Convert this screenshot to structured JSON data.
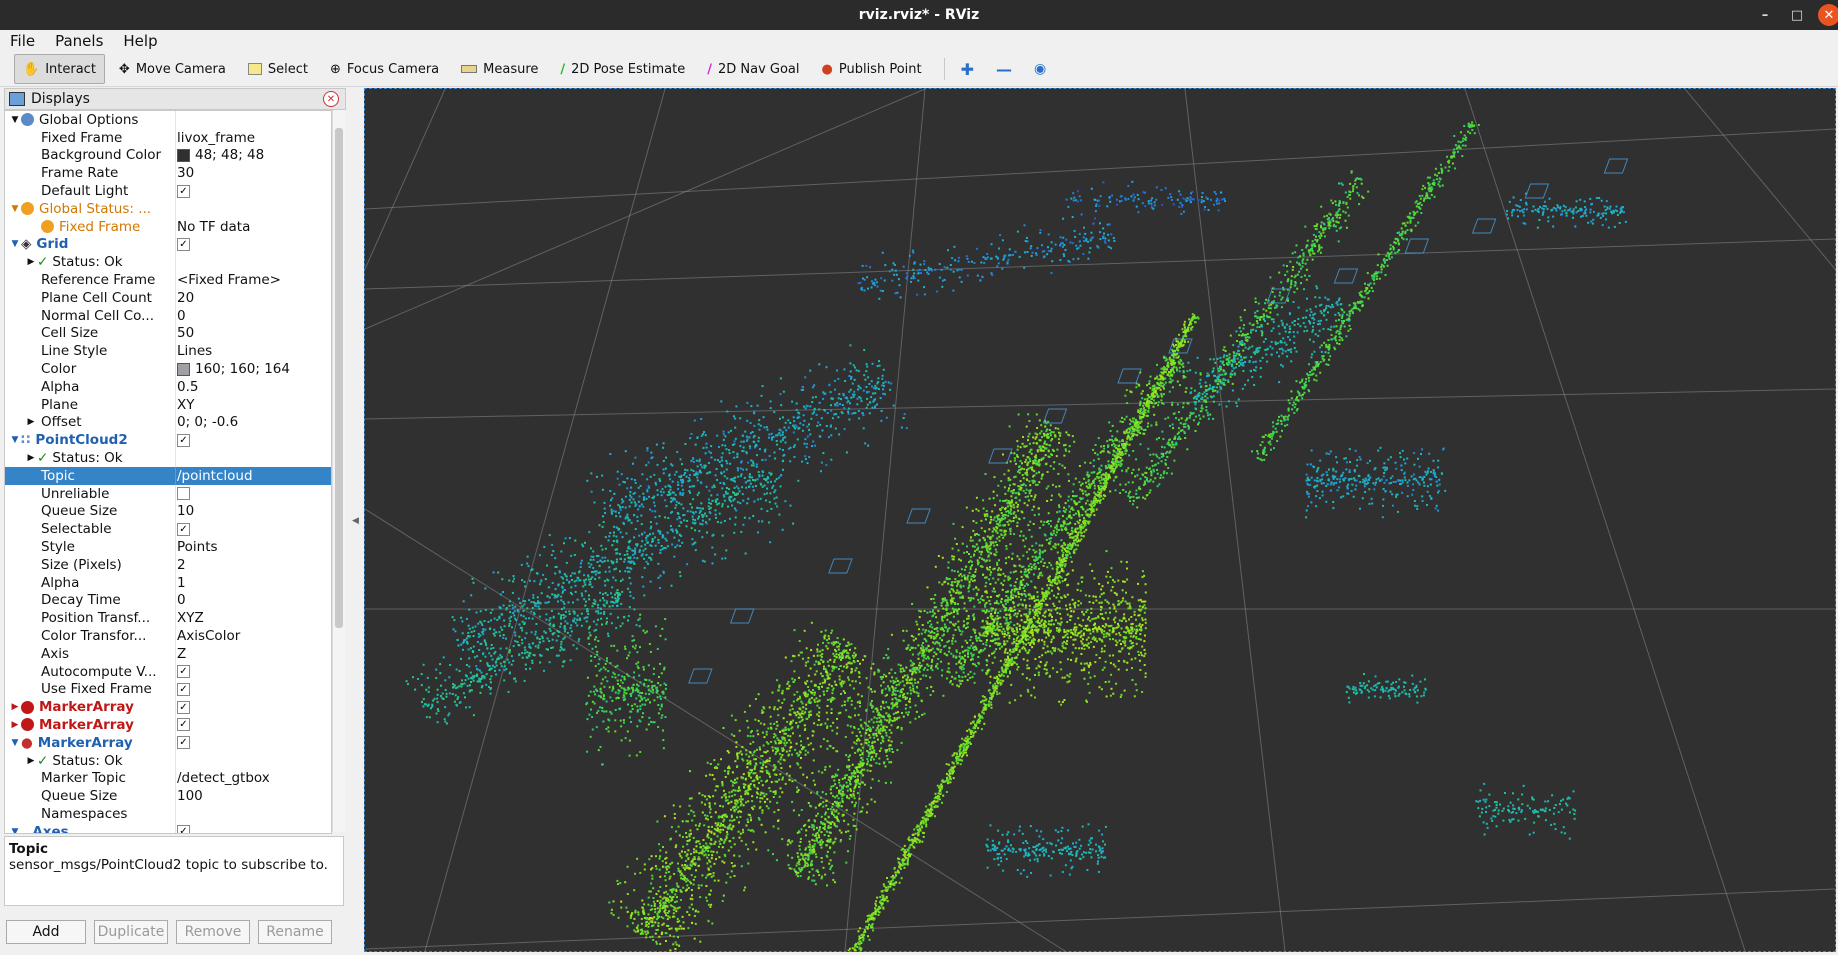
{
  "window": {
    "title": "rviz.rviz* - RViz"
  },
  "menu": {
    "file": "File",
    "panels": "Panels",
    "help": "Help"
  },
  "toolbar": {
    "interact": "Interact",
    "move_camera": "Move Camera",
    "select": "Select",
    "focus_camera": "Focus Camera",
    "measure": "Measure",
    "pose_estimate": "2D Pose Estimate",
    "nav_goal": "2D Nav Goal",
    "publish_point": "Publish Point"
  },
  "displays": {
    "title": "Displays",
    "rows": [
      {
        "name": "Global Options",
        "value": ""
      },
      {
        "name": "Fixed Frame",
        "value": "livox_frame"
      },
      {
        "name": "Background Color",
        "value": "48; 48; 48"
      },
      {
        "name": "Frame Rate",
        "value": "30"
      },
      {
        "name": "Default Light",
        "value": ""
      },
      {
        "name": "Global Status: ...",
        "value": ""
      },
      {
        "name": "Fixed Frame",
        "value": "No TF data"
      },
      {
        "name": "Grid",
        "value": ""
      },
      {
        "name": "Status: Ok",
        "value": ""
      },
      {
        "name": "Reference Frame",
        "value": "<Fixed Frame>"
      },
      {
        "name": "Plane Cell Count",
        "value": "20"
      },
      {
        "name": "Normal Cell Co...",
        "value": "0"
      },
      {
        "name": "Cell Size",
        "value": "50"
      },
      {
        "name": "Line Style",
        "value": "Lines"
      },
      {
        "name": "Color",
        "value": "160; 160; 164"
      },
      {
        "name": "Alpha",
        "value": "0.5"
      },
      {
        "name": "Plane",
        "value": "XY"
      },
      {
        "name": "Offset",
        "value": "0; 0; -0.6"
      },
      {
        "name": "PointCloud2",
        "value": ""
      },
      {
        "name": "Status: Ok",
        "value": ""
      },
      {
        "name": "Topic",
        "value": "/pointcloud"
      },
      {
        "name": "Unreliable",
        "value": ""
      },
      {
        "name": "Queue Size",
        "value": "10"
      },
      {
        "name": "Selectable",
        "value": ""
      },
      {
        "name": "Style",
        "value": "Points"
      },
      {
        "name": "Size (Pixels)",
        "value": "2"
      },
      {
        "name": "Alpha",
        "value": "1"
      },
      {
        "name": "Decay Time",
        "value": "0"
      },
      {
        "name": "Position Transf...",
        "value": "XYZ"
      },
      {
        "name": "Color Transfor...",
        "value": "AxisColor"
      },
      {
        "name": "Axis",
        "value": "Z"
      },
      {
        "name": "Autocompute V...",
        "value": ""
      },
      {
        "name": "Use Fixed Frame",
        "value": ""
      },
      {
        "name": "MarkerArray",
        "value": ""
      },
      {
        "name": "MarkerArray",
        "value": ""
      },
      {
        "name": "MarkerArray",
        "value": ""
      },
      {
        "name": "Status: Ok",
        "value": ""
      },
      {
        "name": "Marker Topic",
        "value": "/detect_gtbox"
      },
      {
        "name": "Queue Size",
        "value": "100"
      },
      {
        "name": "Namespaces",
        "value": ""
      },
      {
        "name": "Axes",
        "value": ""
      }
    ]
  },
  "description": {
    "title": "Topic",
    "text": "sensor_msgs/PointCloud2 topic to subscribe to."
  },
  "buttons": {
    "add": "Add",
    "duplicate": "Duplicate",
    "remove": "Remove",
    "rename": "Rename"
  },
  "colors": {
    "background": "#303030",
    "grid": "#a0a0a4",
    "selection": "#3584c8",
    "error": "#c01818"
  }
}
